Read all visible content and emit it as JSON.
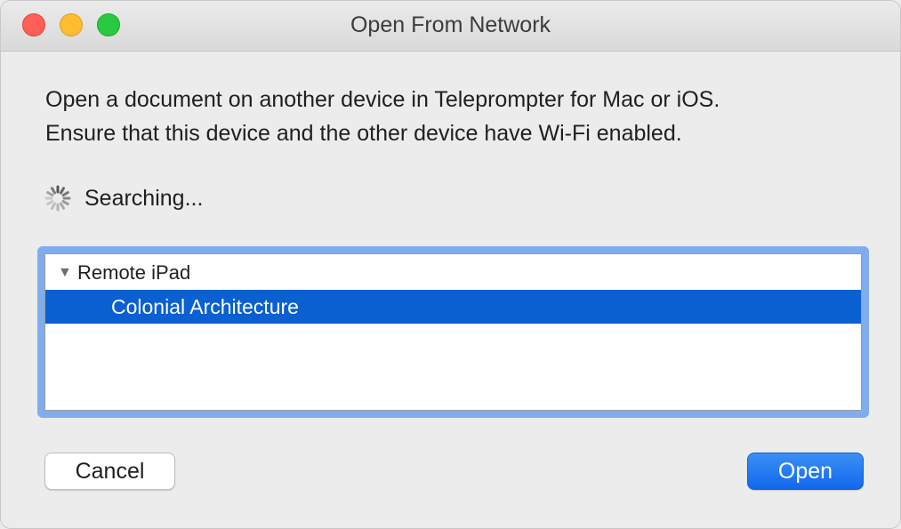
{
  "window": {
    "title": "Open From Network"
  },
  "message": {
    "line1": "Open a document on another device in Teleprompter for Mac or iOS.",
    "line2": "Ensure that this device and the other device have Wi-Fi enabled."
  },
  "status": {
    "text": "Searching...",
    "icon": "spinner-icon"
  },
  "devices": [
    {
      "name": "Remote iPad",
      "expanded": true,
      "disclosure_glyph": "▼",
      "documents": [
        {
          "name": "Colonial Architecture",
          "selected": true
        }
      ]
    }
  ],
  "buttons": {
    "cancel_label": "Cancel",
    "open_label": "Open"
  },
  "colors": {
    "selection": "#0a5fd1",
    "default_button": "#1168ec",
    "focus_ring": "#7fadee",
    "close": "#fe5f57",
    "minimize": "#febc2e",
    "maximize": "#28c840"
  }
}
